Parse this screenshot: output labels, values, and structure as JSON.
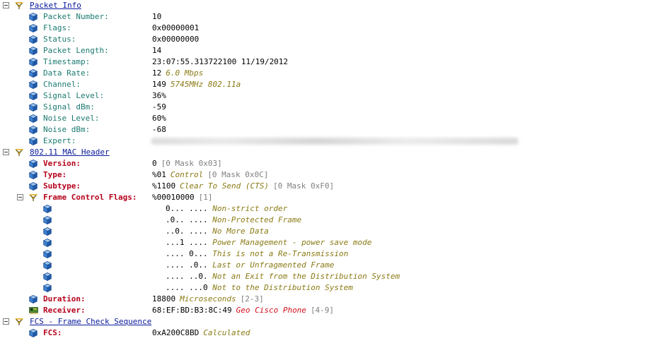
{
  "colors": {
    "section": "#0a1a9c",
    "field": "#1b7a70",
    "field_red": "#b5001a",
    "desc": "#8a7a14",
    "gray": "#808080",
    "red_text": "#d0101a"
  },
  "icons": {
    "section": "antenna-icon",
    "field": "cube-icon",
    "receiver": "network-card-icon",
    "toggle": "collapse-minus-icon"
  },
  "packet_info": {
    "title": "Packet Info",
    "fields": [
      {
        "label": "Packet Number:",
        "value": "10",
        "desc": ""
      },
      {
        "label": "Flags:",
        "value": "0x00000001",
        "desc": ""
      },
      {
        "label": "Status:",
        "value": "0x00000000",
        "desc": ""
      },
      {
        "label": "Packet Length:",
        "value": "14",
        "desc": ""
      },
      {
        "label": "Timestamp:",
        "value": "23:07:55.313722100 11/19/2012",
        "desc": ""
      },
      {
        "label": "Data Rate:",
        "value": "12",
        "desc": "6.0 Mbps"
      },
      {
        "label": "Channel:",
        "value": "149",
        "desc": "5745MHz  802.11a"
      },
      {
        "label": "Signal Level:",
        "value": "36%",
        "desc": ""
      },
      {
        "label": "Signal dBm:",
        "value": "-59",
        "desc": ""
      },
      {
        "label": "Noise Level:",
        "value": "60%",
        "desc": ""
      },
      {
        "label": "Noise dBm:",
        "value": "-68",
        "desc": ""
      },
      {
        "label": "Expert:",
        "value": "",
        "desc": ""
      }
    ]
  },
  "mac_header": {
    "title": "802.11 MAC Header",
    "version": {
      "label": "Version:",
      "value": "0",
      "mask": "[0 Mask 0x03]"
    },
    "type": {
      "label": "Type:",
      "value": "%01",
      "desc": "Control",
      "mask": "[0 Mask 0x0C]"
    },
    "subtype": {
      "label": "Subtype:",
      "value": "%1100",
      "desc": "Clear To Send (CTS)",
      "mask": "[0 Mask 0xF0]"
    },
    "frame_control": {
      "label": "Frame Control Flags:",
      "value": "%00010000",
      "mask": "[1]",
      "bits": [
        {
          "bits": "0... ....",
          "desc": "Non-strict order"
        },
        {
          "bits": ".0.. ....",
          "desc": "Non-Protected Frame"
        },
        {
          "bits": "..0. ....",
          "desc": "No More Data"
        },
        {
          "bits": "...1 ....",
          "desc": "Power Management - power save mode"
        },
        {
          "bits": ".... 0...",
          "desc": "This is not a Re-Transmission"
        },
        {
          "bits": ".... .0..",
          "desc": "Last or Unfragmented Frame"
        },
        {
          "bits": ".... ..0.",
          "desc": "Not an Exit from the Distribution System"
        },
        {
          "bits": ".... ...0",
          "desc": "Not to the Distribution System"
        }
      ]
    },
    "duration": {
      "label": "Duration:",
      "value": "18800",
      "desc": "Microseconds",
      "mask": "[2-3]"
    },
    "receiver": {
      "label": "Receiver:",
      "value": "68:EF:BD:B3:8C:49",
      "desc": "Geo Cisco Phone",
      "mask": "[4-9]"
    }
  },
  "fcs": {
    "title": "FCS - Frame Check Sequence",
    "field": {
      "label": "FCS:",
      "value": "0xA200C8BD",
      "desc": "Calculated"
    }
  }
}
